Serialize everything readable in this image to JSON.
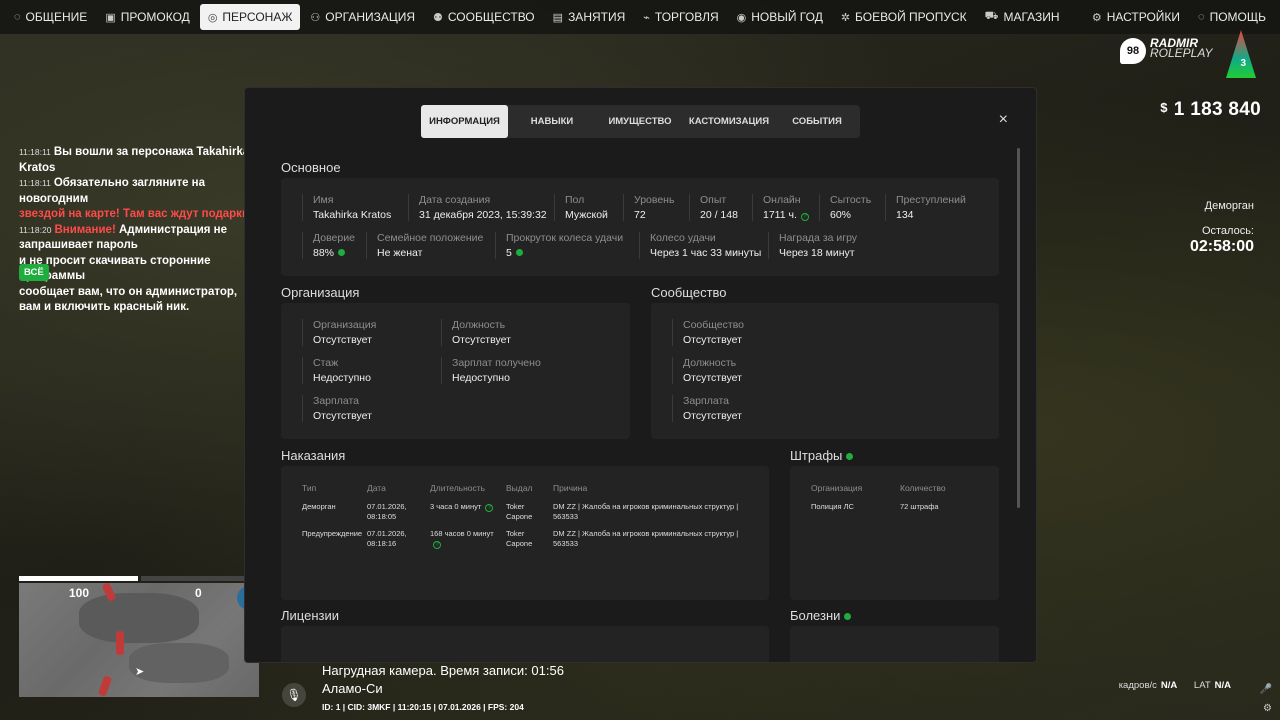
{
  "nav": {
    "left": [
      {
        "label": "ОБЩЕНИЕ",
        "icon": "chat-icon"
      },
      {
        "label": "ПРОМОКОД",
        "icon": "gift-icon"
      },
      {
        "label": "ПЕРСОНАЖ",
        "icon": "user-icon",
        "active": true
      },
      {
        "label": "ОРГАНИЗАЦИЯ",
        "icon": "org-icon"
      },
      {
        "label": "СООБЩЕСТВО",
        "icon": "community-icon"
      },
      {
        "label": "ЗАНЯТИЯ",
        "icon": "book-icon"
      },
      {
        "label": "ТОРГОВЛЯ",
        "icon": "chart-icon"
      },
      {
        "label": "НОВЫЙ ГОД",
        "icon": "ornament-icon"
      },
      {
        "label": "БОЕВОЙ ПРОПУСК",
        "icon": "gear-badge-icon"
      },
      {
        "label": "МАГАЗИН",
        "icon": "cart-icon"
      }
    ],
    "right": [
      {
        "label": "НАСТРОЙКИ",
        "icon": "settings-icon"
      },
      {
        "label": "ПОМОЩЬ",
        "icon": "help-icon"
      }
    ]
  },
  "logo": {
    "badge": "98",
    "brand": "RADMIR",
    "brand2": "ROLEPLAY",
    "tree_num": "3"
  },
  "money": {
    "currency": "$",
    "amount": "1 183 840"
  },
  "chat": {
    "lines": [
      {
        "time": "11:18:11",
        "text": "Вы вошли за персонажа Takahirka Kratos"
      },
      {
        "time": "11:18:11",
        "text": "Обязательно загляните на новогодним"
      },
      {
        "text": "звездой на карте! Там вас ждут подарки!"
      },
      {
        "time": "11:18:20",
        "warn": "Внимание!",
        "text": " Администрация не запрашивает пароль"
      },
      {
        "text": "и не просит скачивать сторонние программы"
      },
      {
        "text": "сообщает вам, что он администратор,"
      },
      {
        "text": "вам и включить красный ник."
      }
    ],
    "all_button": "ВСЁ"
  },
  "jail": {
    "place": "Деморган",
    "left_label": "Осталось:",
    "left_time": "02:58:00"
  },
  "hud": {
    "hp": 1.0,
    "armor": 0.0,
    "hp_text": "100",
    "armor_text": "0"
  },
  "bottom": {
    "line1": "Нагрудная камера. Время записи: 01:56",
    "line2": "Аламо-Си",
    "line3": "ID: 1 | CID: 3MKF | 11:20:15   | 07.01.2026 | FPS: 204",
    "fps_label": "кадров/с",
    "fps_val": "N/A",
    "lat_label": "LAT",
    "lat_val": "N/A"
  },
  "modal": {
    "tabs": [
      "ИНФОРМАЦИЯ",
      "НАВЫКИ",
      "ИМУЩЕСТВО",
      "КАСТОМИЗАЦИЯ",
      "СОБЫТИЯ"
    ],
    "close": "×",
    "main": {
      "title": "Основное",
      "row1": [
        {
          "label": "Имя",
          "value": "Takahirka Kratos"
        },
        {
          "label": "Дата создания",
          "value": "31 декабря 2023, 15:39:32"
        },
        {
          "label": "Пол",
          "value": "Мужской"
        },
        {
          "label": "Уровень",
          "value": "72"
        },
        {
          "label": "Опыт",
          "value": "20 / 148"
        },
        {
          "label": "Онлайн",
          "value": "1711 ч."
        },
        {
          "label": "Сытость",
          "value": "60%"
        },
        {
          "label": "Преступлений",
          "value": "134"
        }
      ],
      "row2": [
        {
          "label": "Доверие",
          "value": "88%"
        },
        {
          "label": "Семейное положение",
          "value": "Не женат"
        },
        {
          "label": "Прокруток колеса удачи",
          "value": "5"
        },
        {
          "label": "Колесо удачи",
          "value": "Через 1 час 33 минуты"
        },
        {
          "label": "Награда за игру",
          "value": "Через 18 минут"
        }
      ]
    },
    "org": {
      "title": "Организация",
      "fields": [
        {
          "label": "Организация",
          "value": "Отсутствует"
        },
        {
          "label": "Должность",
          "value": "Отсутствует"
        },
        {
          "label": "Стаж",
          "value": "Недоступно"
        },
        {
          "label": "Зарплат получено",
          "value": "Недоступно"
        },
        {
          "label": "Зарплата",
          "value": "Отсутствует"
        }
      ]
    },
    "community": {
      "title": "Сообщество",
      "fields": [
        {
          "label": "Сообщество",
          "value": "Отсутствует"
        },
        {
          "label": "Должность",
          "value": "Отсутствует"
        },
        {
          "label": "Зарплата",
          "value": "Отсутствует"
        }
      ]
    },
    "punish": {
      "title": "Наказания",
      "headers": [
        "Тип",
        "Дата",
        "Длительность",
        "Выдал",
        "Причина"
      ],
      "rows": [
        {
          "type": "Деморган",
          "date": "07.01.2026, 08:18:05",
          "duration": "3 часа 0 минут",
          "by": "Toker Capone",
          "reason": "DM ZZ | Жалоба на игроков криминальных структур | 563533"
        },
        {
          "type": "Предупреждение",
          "date": "07.01.2026, 08:18:16",
          "duration": "168 часов 0 минут",
          "by": "Toker Capone",
          "reason": "DM ZZ | Жалоба на игроков криминальных структур | 563533"
        }
      ]
    },
    "fines": {
      "title": "Штрафы",
      "headers": [
        "Организация",
        "Количество"
      ],
      "rows": [
        {
          "org": "Полиция ЛС",
          "count": "72 штрафа"
        }
      ]
    },
    "licenses": {
      "title": "Лицензии"
    },
    "diseases": {
      "title": "Болезни"
    }
  }
}
